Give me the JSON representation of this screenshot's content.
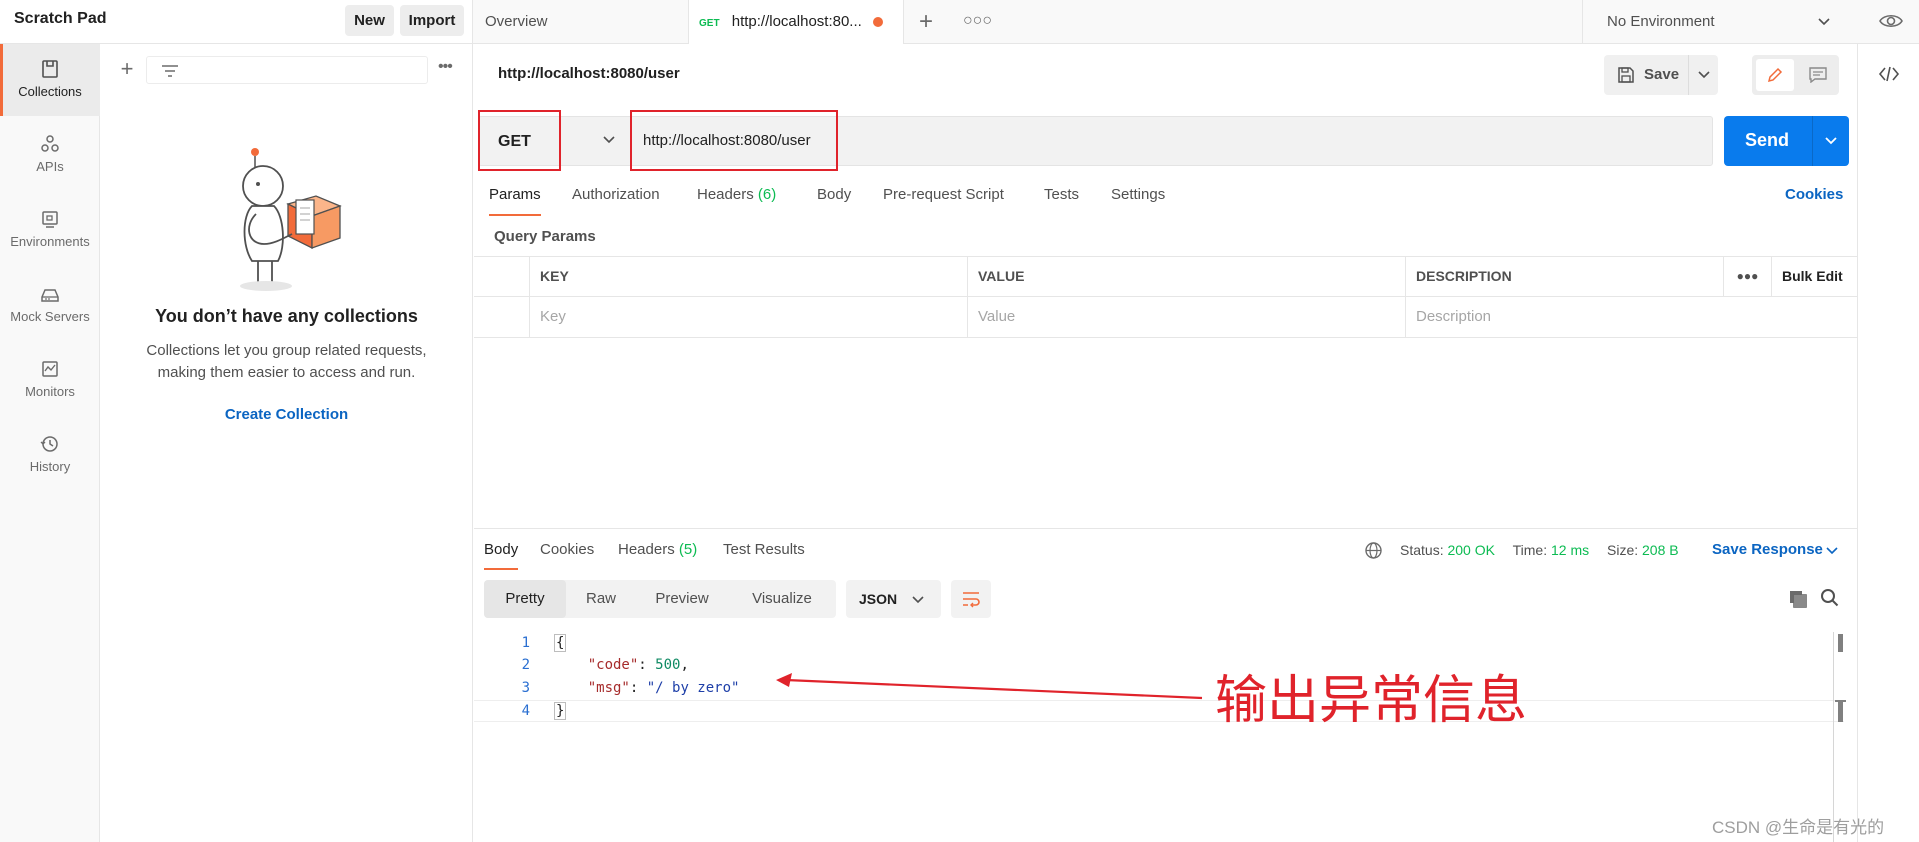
{
  "sidebar": {
    "workspace_title": "Scratch Pad",
    "new_label": "New",
    "import_label": "Import",
    "nav": [
      {
        "label": "Collections",
        "icon": "collections-icon",
        "active": true
      },
      {
        "label": "APIs",
        "icon": "apis-icon"
      },
      {
        "label": "Environments",
        "icon": "environments-icon"
      },
      {
        "label": "Mock Servers",
        "icon": "mock-servers-icon"
      },
      {
        "label": "Monitors",
        "icon": "monitors-icon"
      },
      {
        "label": "History",
        "icon": "history-icon"
      }
    ],
    "empty_title": "You don’t have any collections",
    "empty_desc_line1": "Collections let you group related requests,",
    "empty_desc_line2": "making them easier to access and run.",
    "create_collection": "Create Collection"
  },
  "tabs": {
    "overview": "Overview",
    "request_method": "GET",
    "request_title": "http://localhost:80...",
    "environment": "No Environment"
  },
  "request": {
    "title": "http://localhost:8080/user",
    "save_label": "Save",
    "method": "GET",
    "url": "http://localhost:8080/user",
    "send_label": "Send",
    "tabs": {
      "params": "Params",
      "authorization": "Authorization",
      "headers": "Headers",
      "headers_count": "(6)",
      "body": "Body",
      "pre_request": "Pre-request Script",
      "tests": "Tests",
      "settings": "Settings"
    },
    "cookies": "Cookies",
    "query_params_label": "Query Params",
    "table": {
      "col_key": "KEY",
      "col_value": "VALUE",
      "col_description": "DESCRIPTION",
      "bulk_edit": "Bulk Edit",
      "ph_key": "Key",
      "ph_value": "Value",
      "ph_description": "Description"
    }
  },
  "response": {
    "tabs": {
      "body": "Body",
      "cookies": "Cookies",
      "headers": "Headers",
      "headers_count": "(5)",
      "test_results": "Test Results"
    },
    "status_label": "Status:",
    "status_value": "200 OK",
    "time_label": "Time:",
    "time_value": "12 ms",
    "size_label": "Size:",
    "size_value": "208 B",
    "save_response": "Save Response",
    "views": {
      "pretty": "Pretty",
      "raw": "Raw",
      "preview": "Preview",
      "visualize": "Visualize"
    },
    "format": "JSON",
    "code": {
      "line_numbers": [
        "1",
        "2",
        "3",
        "4"
      ],
      "open_brace": "{",
      "close_brace": "}",
      "code_key": "\"code\"",
      "code_value": "500",
      "msg_key": "\"msg\"",
      "msg_value": "\"/ by zero\""
    }
  },
  "annotation": {
    "text": "输出异常信息",
    "color": "#e0232b"
  },
  "watermark": "CSDN @生命是有光的",
  "colors": {
    "accent_orange": "#f26b3a",
    "send_blue": "#097bed",
    "link_blue": "#0b65c2",
    "success_green": "#0cbb52"
  }
}
